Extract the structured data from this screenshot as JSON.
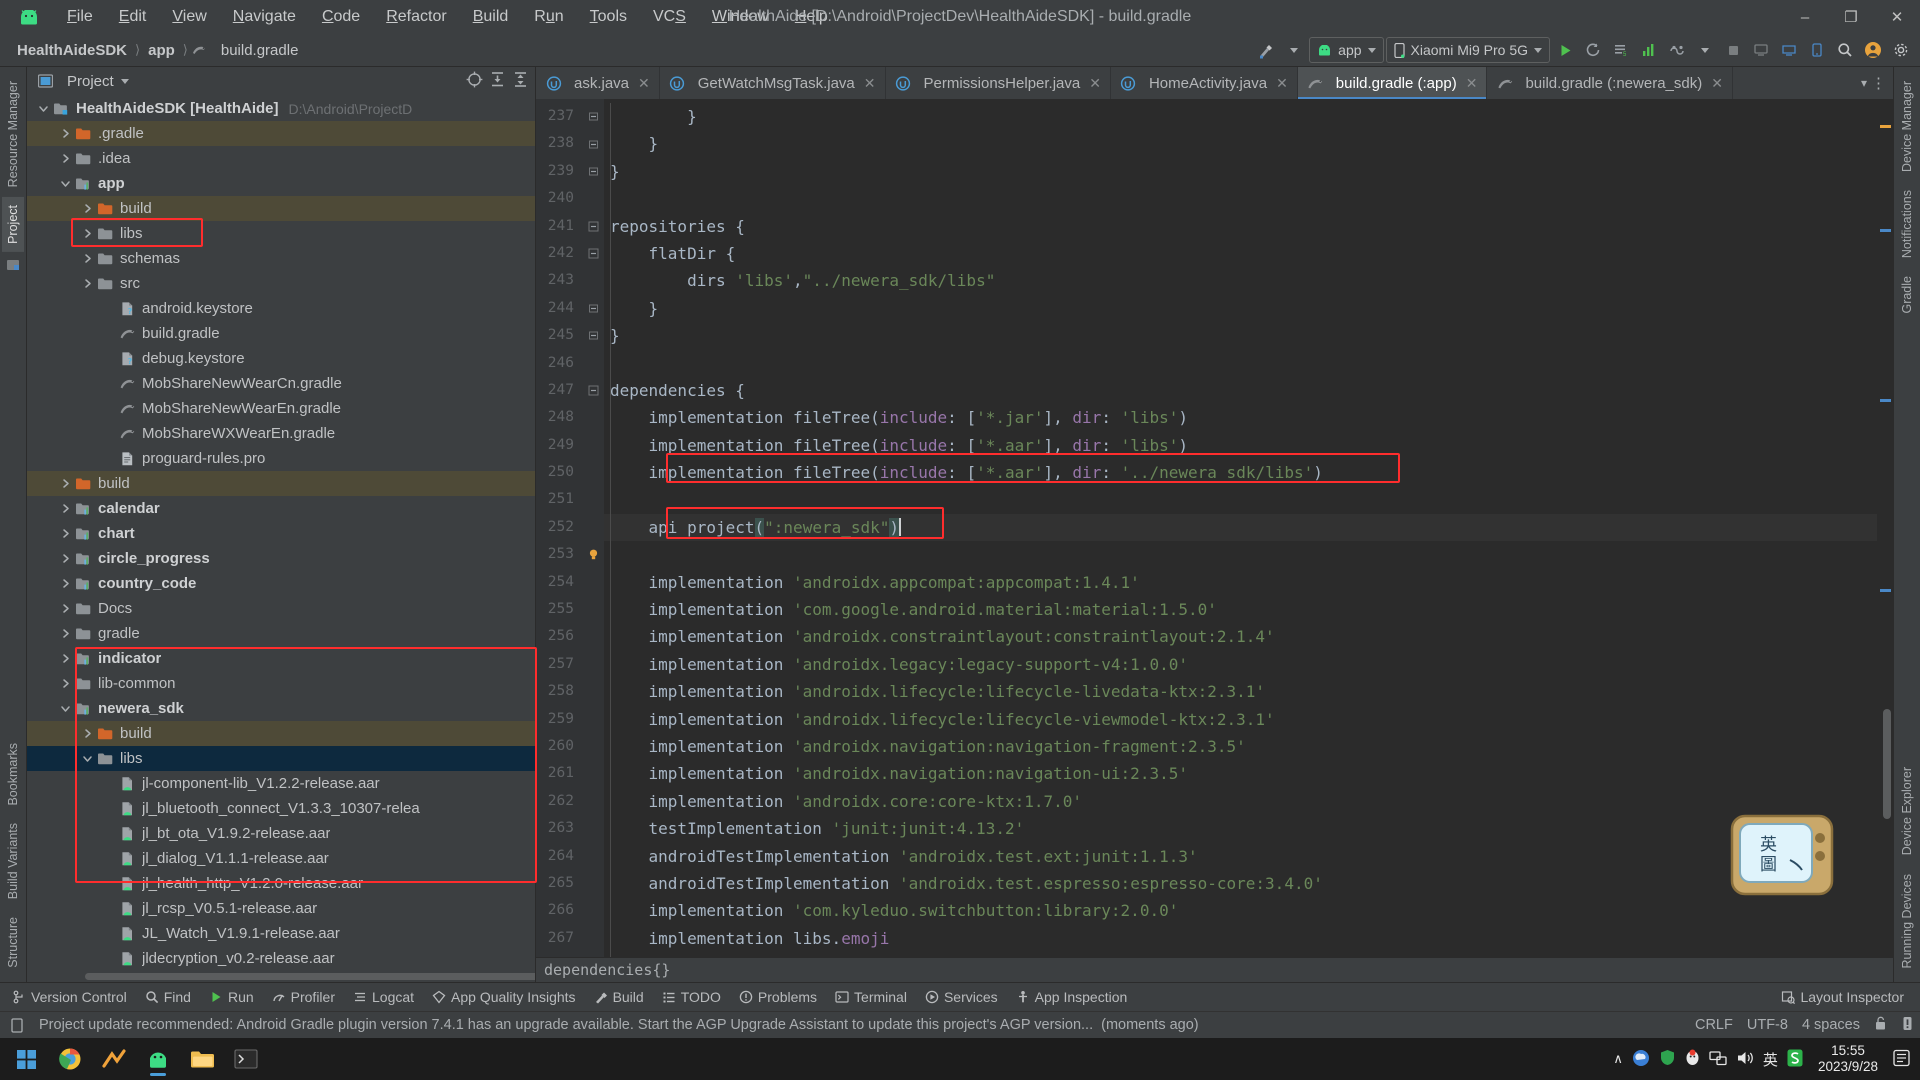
{
  "window": {
    "title": "HealthAide [D:\\Android\\ProjectDev\\HealthAideSDK] - build.gradle",
    "minimize": "–",
    "maximize": "❐",
    "close": "✕"
  },
  "menu": {
    "items": [
      "File",
      "Edit",
      "View",
      "Navigate",
      "Code",
      "Refactor",
      "Build",
      "Run",
      "Tools",
      "VCS",
      "Window",
      "Help"
    ]
  },
  "breadcrumbs": {
    "project": "HealthAideSDK",
    "module": "app",
    "file": "build.gradle"
  },
  "toolbar": {
    "module_selector": "app",
    "device_selector": "Xiaomi Mi9 Pro 5G",
    "run_tooltip": "Run",
    "debug_tooltip": "Debug",
    "search_tooltip": "Search Everywhere"
  },
  "left_rail": {
    "top": [
      "Resource Manager",
      "Project"
    ],
    "bottom": [
      "Bookmarks",
      "Build Variants",
      "Structure"
    ]
  },
  "right_rail": {
    "top": [
      "Device Manager",
      "Notifications",
      "Gradle"
    ],
    "bottom": [
      "Device Explorer",
      "Running Devices"
    ]
  },
  "project_panel": {
    "title": "Project",
    "tree": [
      {
        "depth": 0,
        "arrow": "down",
        "icon": "module-root",
        "label": "HealthAideSDK [HealthAide]",
        "bold": true,
        "note": "D:\\Android\\ProjectD",
        "state": "normal"
      },
      {
        "depth": 1,
        "arrow": "right",
        "icon": "folder-orange",
        "label": ".gradle",
        "bold": false,
        "note": "",
        "state": "dim"
      },
      {
        "depth": 1,
        "arrow": "right",
        "icon": "folder",
        "label": ".idea",
        "bold": false,
        "note": "",
        "state": "normal"
      },
      {
        "depth": 1,
        "arrow": "down",
        "icon": "module",
        "label": "app",
        "bold": true,
        "note": "",
        "state": "normal"
      },
      {
        "depth": 2,
        "arrow": "right",
        "icon": "folder-orange",
        "label": "build",
        "bold": false,
        "note": "",
        "state": "dim"
      },
      {
        "depth": 2,
        "arrow": "right",
        "icon": "folder",
        "label": "libs",
        "bold": false,
        "note": "",
        "state": "normal"
      },
      {
        "depth": 2,
        "arrow": "right",
        "icon": "folder",
        "label": "schemas",
        "bold": false,
        "note": "",
        "state": "normal"
      },
      {
        "depth": 2,
        "arrow": "right",
        "icon": "folder",
        "label": "src",
        "bold": false,
        "note": "",
        "state": "normal"
      },
      {
        "depth": 3,
        "arrow": "none",
        "icon": "file-unknown",
        "label": "android.keystore",
        "bold": false,
        "note": "",
        "state": "normal"
      },
      {
        "depth": 3,
        "arrow": "none",
        "icon": "gradle-file",
        "label": "build.gradle",
        "bold": false,
        "note": "",
        "state": "normal"
      },
      {
        "depth": 3,
        "arrow": "none",
        "icon": "file-unknown",
        "label": "debug.keystore",
        "bold": false,
        "note": "",
        "state": "normal"
      },
      {
        "depth": 3,
        "arrow": "none",
        "icon": "gradle-file",
        "label": "MobShareNewWearCn.gradle",
        "bold": false,
        "note": "",
        "state": "normal"
      },
      {
        "depth": 3,
        "arrow": "none",
        "icon": "gradle-file",
        "label": "MobShareNewWearEn.gradle",
        "bold": false,
        "note": "",
        "state": "normal"
      },
      {
        "depth": 3,
        "arrow": "none",
        "icon": "gradle-file",
        "label": "MobShareWXWearEn.gradle",
        "bold": false,
        "note": "",
        "state": "normal"
      },
      {
        "depth": 3,
        "arrow": "none",
        "icon": "file-text",
        "label": "proguard-rules.pro",
        "bold": false,
        "note": "",
        "state": "normal"
      },
      {
        "depth": 1,
        "arrow": "right",
        "icon": "folder-orange",
        "label": "build",
        "bold": false,
        "note": "",
        "state": "dim"
      },
      {
        "depth": 1,
        "arrow": "right",
        "icon": "module",
        "label": "calendar",
        "bold": true,
        "note": "",
        "state": "normal"
      },
      {
        "depth": 1,
        "arrow": "right",
        "icon": "module",
        "label": "chart",
        "bold": true,
        "note": "",
        "state": "normal"
      },
      {
        "depth": 1,
        "arrow": "right",
        "icon": "module",
        "label": "circle_progress",
        "bold": true,
        "note": "",
        "state": "normal"
      },
      {
        "depth": 1,
        "arrow": "right",
        "icon": "module",
        "label": "country_code",
        "bold": true,
        "note": "",
        "state": "normal"
      },
      {
        "depth": 1,
        "arrow": "right",
        "icon": "folder",
        "label": "Docs",
        "bold": false,
        "note": "",
        "state": "normal"
      },
      {
        "depth": 1,
        "arrow": "right",
        "icon": "folder",
        "label": "gradle",
        "bold": false,
        "note": "",
        "state": "normal"
      },
      {
        "depth": 1,
        "arrow": "right",
        "icon": "module",
        "label": "indicator",
        "bold": true,
        "note": "",
        "state": "normal"
      },
      {
        "depth": 1,
        "arrow": "right",
        "icon": "folder",
        "label": "lib-common",
        "bold": false,
        "note": "",
        "state": "normal"
      },
      {
        "depth": 1,
        "arrow": "down",
        "icon": "module",
        "label": "newera_sdk",
        "bold": true,
        "note": "",
        "state": "normal"
      },
      {
        "depth": 2,
        "arrow": "right",
        "icon": "folder-orange",
        "label": "build",
        "bold": false,
        "note": "",
        "state": "dim"
      },
      {
        "depth": 2,
        "arrow": "down",
        "icon": "folder",
        "label": "libs",
        "bold": false,
        "note": "",
        "state": "selected"
      },
      {
        "depth": 3,
        "arrow": "none",
        "icon": "aar",
        "label": "jl-component-lib_V1.2.2-release.aar",
        "bold": false,
        "note": "",
        "state": "normal"
      },
      {
        "depth": 3,
        "arrow": "none",
        "icon": "aar",
        "label": "jl_bluetooth_connect_V1.3.3_10307-relea",
        "bold": false,
        "note": "",
        "state": "normal"
      },
      {
        "depth": 3,
        "arrow": "none",
        "icon": "aar",
        "label": "jl_bt_ota_V1.9.2-release.aar",
        "bold": false,
        "note": "",
        "state": "normal"
      },
      {
        "depth": 3,
        "arrow": "none",
        "icon": "aar",
        "label": "jl_dialog_V1.1.1-release.aar",
        "bold": false,
        "note": "",
        "state": "normal"
      },
      {
        "depth": 3,
        "arrow": "none",
        "icon": "aar",
        "label": "jl_health_http_V1.2.0-release.aar",
        "bold": false,
        "note": "",
        "state": "normal"
      },
      {
        "depth": 3,
        "arrow": "none",
        "icon": "aar",
        "label": "jl_rcsp_V0.5.1-release.aar",
        "bold": false,
        "note": "",
        "state": "normal"
      },
      {
        "depth": 3,
        "arrow": "none",
        "icon": "aar",
        "label": "JL_Watch_V1.9.1-release.aar",
        "bold": false,
        "note": "",
        "state": "normal"
      },
      {
        "depth": 3,
        "arrow": "none",
        "icon": "aar",
        "label": "jldecryption_v0.2-release.aar",
        "bold": false,
        "note": "",
        "state": "normal"
      }
    ]
  },
  "editor_tabs": [
    {
      "label": "ask.java",
      "icon": "java",
      "active": false,
      "truncated": true
    },
    {
      "label": "GetWatchMsgTask.java",
      "icon": "java",
      "active": false,
      "truncated": false
    },
    {
      "label": "PermissionsHelper.java",
      "icon": "java",
      "active": false,
      "truncated": false
    },
    {
      "label": "HomeActivity.java",
      "icon": "java",
      "active": false,
      "truncated": false
    },
    {
      "label": "build.gradle (:app)",
      "icon": "gradle",
      "active": true,
      "truncated": false
    },
    {
      "label": "build.gradle (:newera_sdk)",
      "icon": "gradle",
      "active": false,
      "truncated": false
    }
  ],
  "code": {
    "first_line_number": 237,
    "lines": [
      {
        "n": 237,
        "fold": "end",
        "html": "        }"
      },
      {
        "n": 238,
        "fold": "end",
        "html": "    }"
      },
      {
        "n": 239,
        "fold": "end",
        "html": "}"
      },
      {
        "n": 240,
        "fold": "",
        "html": ""
      },
      {
        "n": 241,
        "fold": "open",
        "html": "repositories {"
      },
      {
        "n": 242,
        "fold": "open",
        "html": "    flatDir {"
      },
      {
        "n": 243,
        "fold": "",
        "html": "        dirs 'libs',\"../newera_sdk/libs\""
      },
      {
        "n": 244,
        "fold": "end",
        "html": "    }"
      },
      {
        "n": 245,
        "fold": "end",
        "html": "}"
      },
      {
        "n": 246,
        "fold": "",
        "html": ""
      },
      {
        "n": 247,
        "fold": "open",
        "html": "dependencies {"
      },
      {
        "n": 248,
        "fold": "",
        "html": "    implementation fileTree(include: ['*.jar'], dir: 'libs')"
      },
      {
        "n": 249,
        "fold": "",
        "html": "    implementation fileTree(include: ['*.aar'], dir: 'libs')"
      },
      {
        "n": 250,
        "fold": "",
        "html": "    implementation fileTree(include: ['*.aar'], dir: '../newera_sdk/libs')"
      },
      {
        "n": 251,
        "fold": "",
        "html": ""
      },
      {
        "n": 252,
        "fold": "",
        "html": "    api project(\":newera_sdk\")"
      },
      {
        "n": 253,
        "fold": "bulb",
        "html": ""
      },
      {
        "n": 254,
        "fold": "",
        "html": "    implementation 'androidx.appcompat:appcompat:1.4.1'"
      },
      {
        "n": 255,
        "fold": "",
        "html": "    implementation 'com.google.android.material:material:1.5.0'"
      },
      {
        "n": 256,
        "fold": "",
        "html": "    implementation 'androidx.constraintlayout:constraintlayout:2.1.4'"
      },
      {
        "n": 257,
        "fold": "",
        "html": "    implementation 'androidx.legacy:legacy-support-v4:1.0.0'"
      },
      {
        "n": 258,
        "fold": "",
        "html": "    implementation 'androidx.lifecycle:lifecycle-livedata-ktx:2.3.1'"
      },
      {
        "n": 259,
        "fold": "",
        "html": "    implementation 'androidx.lifecycle:lifecycle-viewmodel-ktx:2.3.1'"
      },
      {
        "n": 260,
        "fold": "",
        "html": "    implementation 'androidx.navigation:navigation-fragment:2.3.5'"
      },
      {
        "n": 261,
        "fold": "",
        "html": "    implementation 'androidx.navigation:navigation-ui:2.3.5'"
      },
      {
        "n": 262,
        "fold": "",
        "html": "    implementation 'androidx.core:core-ktx:1.7.0'"
      },
      {
        "n": 263,
        "fold": "",
        "html": "    testImplementation 'junit:junit:4.13.2'"
      },
      {
        "n": 264,
        "fold": "",
        "html": "    androidTestImplementation 'androidx.test.ext:junit:1.1.3'"
      },
      {
        "n": 265,
        "fold": "",
        "html": "    androidTestImplementation 'androidx.test.espresso:espresso-core:3.4.0'"
      },
      {
        "n": 266,
        "fold": "",
        "html": "    implementation 'com.kyleduo.switchbutton:library:2.0.0'"
      },
      {
        "n": 267,
        "fold": "",
        "html": "    implementation libs.emoji"
      },
      {
        "n": 268,
        "fold": "",
        "html": ""
      }
    ],
    "editor_breadcrumb": "dependencies{}"
  },
  "bottom_tools": {
    "left": [
      {
        "label": "Version Control",
        "icon": "branch-icon"
      },
      {
        "label": "Find",
        "icon": "search-icon"
      },
      {
        "label": "Run",
        "icon": "play-icon"
      },
      {
        "label": "Profiler",
        "icon": "profiler-icon"
      },
      {
        "label": "Logcat",
        "icon": "logcat-icon"
      },
      {
        "label": "App Quality Insights",
        "icon": "diamond-icon"
      },
      {
        "label": "Build",
        "icon": "hammer-icon"
      },
      {
        "label": "TODO",
        "icon": "list-icon"
      },
      {
        "label": "Problems",
        "icon": "warning-icon"
      },
      {
        "label": "Terminal",
        "icon": "terminal-icon"
      },
      {
        "label": "Services",
        "icon": "services-icon"
      },
      {
        "label": "App Inspection",
        "icon": "inspection-icon"
      }
    ],
    "right": [
      {
        "label": "Layout Inspector",
        "icon": "layout-inspector-icon"
      }
    ]
  },
  "status_bar": {
    "message": "Project update recommended: Android Gradle plugin version 7.4.1 has an upgrade available. Start the AGP Upgrade Assistant to update this project's AGP version...",
    "timestamp": "(moments ago)",
    "line_separator": "CRLF",
    "encoding": "UTF-8",
    "indent": "4 spaces"
  },
  "taskbar": {
    "time": "15:55",
    "date": "2023/9/28",
    "ime": "英",
    "chevron": "∧"
  },
  "annotations": {
    "box_app": "app folder highlighted",
    "box_newera": "newera_sdk libs highlighted",
    "box_filetree": "fileTree newera_sdk line highlighted",
    "box_api": "api project(':newera_sdk') highlighted",
    "color": "#ff2d2d"
  }
}
